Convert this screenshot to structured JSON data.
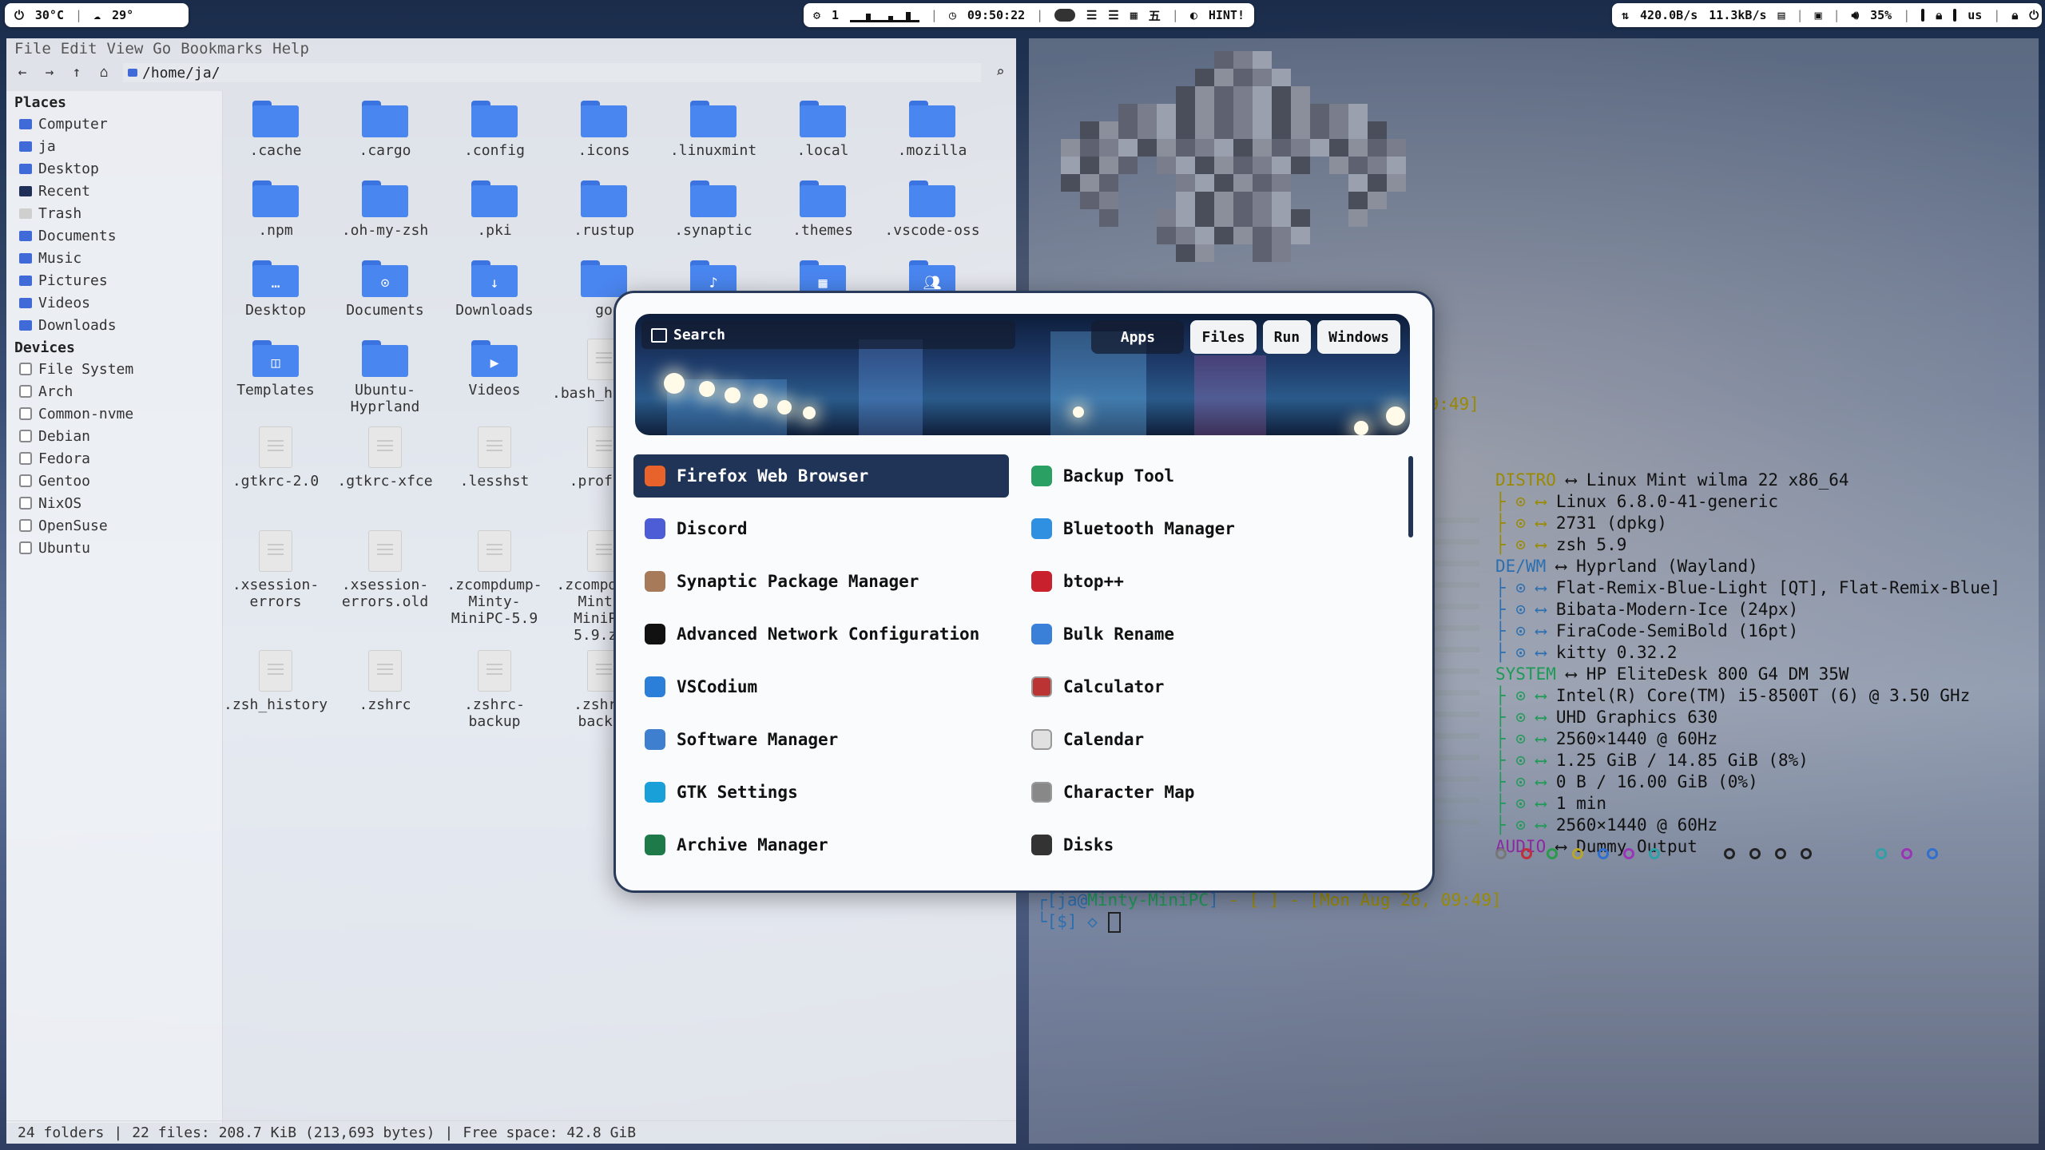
{
  "topbar": {
    "left": {
      "temp": "30°C",
      "weather": "29°"
    },
    "center": {
      "workspace": "1",
      "time": "09:50:22",
      "hint": "HINT!"
    },
    "right": {
      "down": "420.0B/s",
      "up": "11.3kB/s",
      "volume": "35%",
      "lang": "us"
    }
  },
  "filemanager": {
    "menu": [
      "File",
      "Edit",
      "View",
      "Go",
      "Bookmarks",
      "Help"
    ],
    "path": "/home/ja/",
    "places_heading": "Places",
    "places": [
      "Computer",
      "ja",
      "Desktop",
      "Recent",
      "Trash",
      "Documents",
      "Music",
      "Pictures",
      "Videos",
      "Downloads"
    ],
    "devices_heading": "Devices",
    "devices": [
      "File System",
      "Arch",
      "Common-nvme",
      "Debian",
      "Fedora",
      "Gentoo",
      "NixOS",
      "OpenSuse",
      "Ubuntu"
    ],
    "items": [
      ".cache",
      ".cargo",
      ".config",
      ".icons",
      ".linuxmint",
      ".local",
      ".mozilla",
      ".npm",
      ".oh-my-zsh",
      ".pki",
      ".rustup",
      ".synaptic",
      ".themes",
      ".vscode-oss",
      "Desktop",
      "Documents",
      "Downloads",
      "go",
      "",
      "",
      "",
      "Templates",
      "Ubuntu-Hyprland",
      "Videos",
      ".bash_history",
      ".gtkrc-2.0",
      ".gtkrc-xfce",
      ".lesshst",
      ".profile",
      ".xsession-errors",
      ".xsession-errors.old",
      ".zcompdump-Minty-MiniPC-5.9",
      ".zcompdump-Minty-MiniPC-5.9.zwc",
      ".zsh_history",
      ".zshrc",
      ".zshrc-backup",
      ".zshrc-backup"
    ],
    "status": {
      "folders": "24 folders",
      "files": "22 files: 208.7 KiB (213,693 bytes)",
      "free": "Free space: 42.8 GiB"
    }
  },
  "launcher": {
    "search_placeholder": "Search",
    "modes": [
      "Apps",
      "Files",
      "Run",
      "Windows"
    ],
    "left_apps": [
      "Firefox Web Browser",
      "Discord",
      "Synaptic Package Manager",
      "Advanced Network Configuration",
      "VSCodium",
      "Software Manager",
      "GTK Settings",
      "Archive Manager"
    ],
    "right_apps": [
      "Backup Tool",
      "Bluetooth Manager",
      "btop++",
      "Bulk Rename",
      "Calculator",
      "Calendar",
      "Character Map",
      "Disks"
    ],
    "selected": "Firefox Web Browser"
  },
  "terminal": {
    "fastfetch": [
      {
        "key": "DISTRO",
        "value": "Linux Mint wilma 22 x86_64"
      },
      {
        "key": "",
        "value": "Linux 6.8.0-41-generic"
      },
      {
        "key": "",
        "value": "2731 (dpkg)"
      },
      {
        "key": "",
        "value": "zsh 5.9"
      },
      {
        "key": "DE/WM",
        "value": "Hyprland (Wayland)"
      },
      {
        "key": "",
        "value": "Flat-Remix-Blue-Light [QT], Flat-Remix-Blue]"
      },
      {
        "key": "",
        "value": "Bibata-Modern-Ice (24px)"
      },
      {
        "key": "",
        "value": "FiraCode-SemiBold (16pt)"
      },
      {
        "key": "",
        "value": "kitty 0.32.2"
      },
      {
        "key": "SYSTEM",
        "value": "HP EliteDesk 800 G4 DM 35W"
      },
      {
        "key": "",
        "value": "Intel(R) Core(TM) i5-8500T (6) @ 3.50 GHz"
      },
      {
        "key": "",
        "value": "UHD Graphics 630"
      },
      {
        "key": "",
        "value": "2560×1440 @ 60Hz"
      },
      {
        "key": "",
        "value": "1.25 GiB / 14.85 GiB (8%)"
      },
      {
        "key": "",
        "value": "0 B / 16.00 GiB (0%)"
      },
      {
        "key": "",
        "value": "1 min"
      },
      {
        "key": "",
        "value": "2560×1440 @ 60Hz"
      },
      {
        "key": "AUDIO",
        "value": "Dummy Output"
      }
    ],
    "prev_time": "5, 09:49]",
    "prompt_user": "ja",
    "prompt_host": "Minty-MiniPC",
    "prompt_time": "Mon Aug 26, 09:49",
    "prompt_symbol": "[$]"
  }
}
